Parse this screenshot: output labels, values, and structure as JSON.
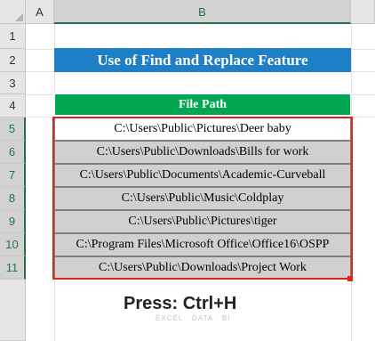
{
  "columns": {
    "a": "A",
    "b": "B"
  },
  "rows": [
    "1",
    "2",
    "3",
    "4",
    "5",
    "6",
    "7",
    "8",
    "9",
    "10",
    "11"
  ],
  "title": "Use of Find and Replace Feature",
  "table": {
    "header": "File Path",
    "cells": [
      "C:\\Users\\Public\\Pictures\\Deer baby",
      "C:\\Users\\Public\\Downloads\\Bills for work",
      "C:\\Users\\Public\\Documents\\Academic-Curveball",
      "C:\\Users\\Public\\Music\\Coldplay",
      "C:\\Users\\Public\\Pictures\\tiger",
      "C:\\Program Files\\Microsoft Office\\Office16\\OSPP",
      "C:\\Users\\Public\\Downloads\\Project Work"
    ]
  },
  "instruction": "Press: Ctrl+H",
  "watermark": "EXCEL · DATA · BI",
  "colors": {
    "title_bg": "#1f7fc6",
    "header_bg": "#00a651",
    "selection": "#e2231a",
    "excel_green": "#217346"
  }
}
